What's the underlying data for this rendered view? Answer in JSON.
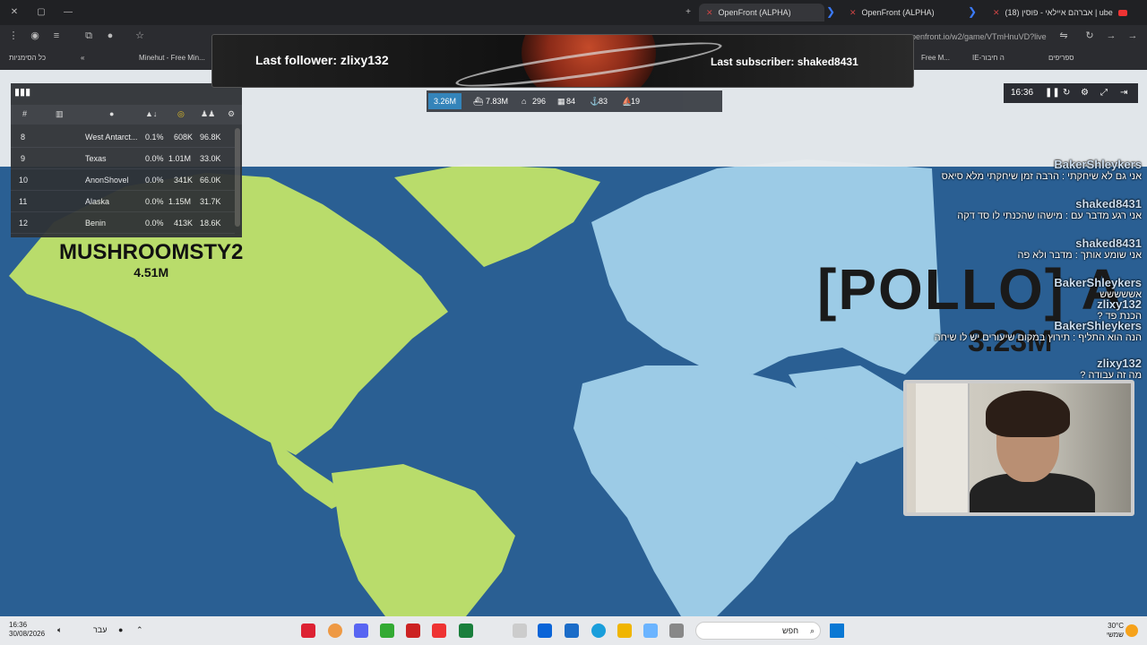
{
  "browser": {
    "tabs": [
      {
        "label": "OpenFront (ALPHA)"
      },
      {
        "label": "OpenFront (ALPHA)"
      },
      {
        "label": "(18) אברהם איילאי - פוסין | ube"
      }
    ],
    "url": "openfront.io/w2/game/VTmHnuVD?live",
    "bookmarks": [
      "כל הסימניות",
      "Minehut - Free Min...",
      "Free M...",
      "IE-ה חיבור",
      "ספריפים"
    ]
  },
  "overlay": {
    "last_follower": "Last follower: zlixy132",
    "last_subscriber": "Last subscriber: shaked8431"
  },
  "hud": {
    "gold": "3.26M",
    "troops": "7.83M",
    "stat1": "296",
    "stat2": "84",
    "stat3": "83",
    "stat4": "19",
    "clock": "16:36"
  },
  "leaderboard": {
    "col_rank": "#",
    "rows": [
      {
        "rank": "8",
        "name": "West Antarct...",
        "land": "0.1%",
        "gold": "608K",
        "troops": "96.8K"
      },
      {
        "rank": "9",
        "name": "Texas",
        "land": "0.0%",
        "gold": "1.01M",
        "troops": "33.0K"
      },
      {
        "rank": "10",
        "name": "AnonShovel",
        "land": "0.0%",
        "gold": "341K",
        "troops": "66.0K"
      },
      {
        "rank": "11",
        "name": "Alaska",
        "land": "0.0%",
        "gold": "1.15M",
        "troops": "31.7K"
      },
      {
        "rank": "12",
        "name": "Benin",
        "land": "0.0%",
        "gold": "413K",
        "troops": "18.6K"
      }
    ]
  },
  "map": {
    "player_name": "MUSHROOMSTY2",
    "player_pop": "4.51M",
    "enemy_name": "[POLLO] A",
    "enemy_pop": "3.23M",
    "colors": {
      "ocean": "#2a5f93",
      "player": "#b9dc6b",
      "enemy": "#9ccbe6"
    }
  },
  "chat": [
    {
      "user": "BakerShleykers",
      "msg": "אני גם לא שיחקתי : הרבה זמן שיחקתי מלא סיאס"
    },
    {
      "user": "shaked8431",
      "msg": "אני רגע מדבר עם : מישהו שהכנתי לו סד דקה"
    },
    {
      "user": "shaked8431",
      "msg": "אני שומע אותך : מדבר ולא פה"
    },
    {
      "user": "BakerShleykers",
      "msg": "אששששש"
    },
    {
      "user": "zlixy132",
      "msg": "הכנת פד ?"
    },
    {
      "user": "BakerShleykers",
      "msg": "הנה הוא התליף : תירוץ במקום שיעורים יש לו שיחה"
    },
    {
      "user": "zlixy132",
      "msg": "מה זה עבודה ?"
    }
  ],
  "taskbar": {
    "time": "16:36",
    "date": "30/08/2026",
    "lang": "עבר",
    "search": "חפש",
    "temp": "30°C",
    "weather": "שמשי"
  }
}
